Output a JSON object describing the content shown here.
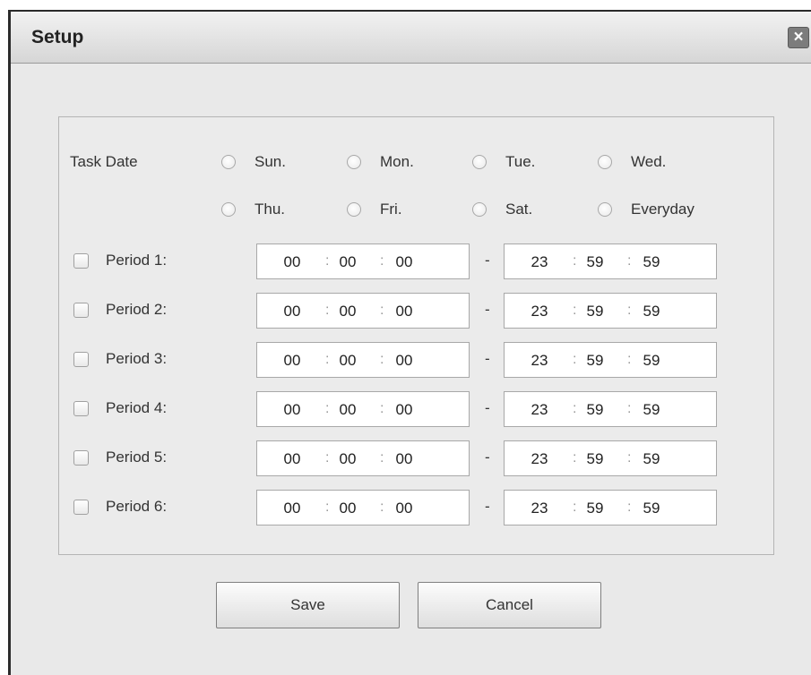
{
  "dialog": {
    "title": "Setup",
    "close_label": "×"
  },
  "task_date": {
    "label": "Task Date",
    "days": [
      "Sun.",
      "Mon.",
      "Tue.",
      "Wed.",
      "Thu.",
      "Fri.",
      "Sat.",
      "Everyday"
    ]
  },
  "periods": [
    {
      "label": "Period 1:",
      "start": [
        "00",
        "00",
        "00"
      ],
      "end": [
        "23",
        "59",
        "59"
      ]
    },
    {
      "label": "Period 2:",
      "start": [
        "00",
        "00",
        "00"
      ],
      "end": [
        "23",
        "59",
        "59"
      ]
    },
    {
      "label": "Period 3:",
      "start": [
        "00",
        "00",
        "00"
      ],
      "end": [
        "23",
        "59",
        "59"
      ]
    },
    {
      "label": "Period 4:",
      "start": [
        "00",
        "00",
        "00"
      ],
      "end": [
        "23",
        "59",
        "59"
      ]
    },
    {
      "label": "Period 5:",
      "start": [
        "00",
        "00",
        "00"
      ],
      "end": [
        "23",
        "59",
        "59"
      ]
    },
    {
      "label": "Period 6:",
      "start": [
        "00",
        "00",
        "00"
      ],
      "end": [
        "23",
        "59",
        "59"
      ]
    }
  ],
  "separators": {
    "time": ":",
    "range": "-"
  },
  "buttons": {
    "save": "Save",
    "cancel": "Cancel"
  }
}
